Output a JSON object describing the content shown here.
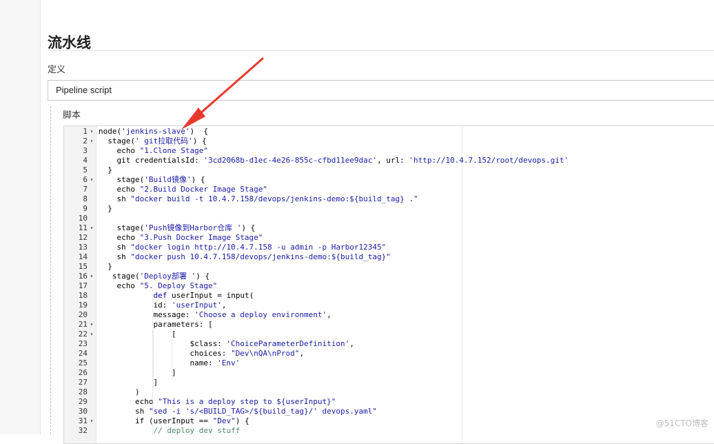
{
  "section": {
    "title": "流水线",
    "definition_label": "定义",
    "definition_value": "Pipeline script",
    "script_label": "脚本"
  },
  "editor": {
    "lines": [
      {
        "n": "1",
        "fold": true,
        "parts": [
          {
            "t": "node("
          },
          {
            "t": "'jenkins-slave'",
            "c": "str"
          },
          {
            "t": ")  {"
          }
        ]
      },
      {
        "n": "2",
        "fold": true,
        "parts": [
          {
            "t": "  stage("
          },
          {
            "t": "' git拉取代码'",
            "c": "str"
          },
          {
            "t": ") {"
          }
        ]
      },
      {
        "n": "3",
        "parts": [
          {
            "t": "    echo "
          },
          {
            "t": "\"1.Clone Stage\"",
            "c": "str"
          }
        ]
      },
      {
        "n": "4",
        "parts": [
          {
            "t": "    git credentialsId: "
          },
          {
            "t": "'3cd2068b-d1ec-4e26-855c-cfbd11ee9dac'",
            "c": "str"
          },
          {
            "t": ", url: "
          },
          {
            "t": "'http://10.4.7.152/root/devops.git'",
            "c": "str"
          }
        ]
      },
      {
        "n": "5",
        "parts": [
          {
            "t": "  }"
          }
        ]
      },
      {
        "n": "6",
        "fold": true,
        "parts": [
          {
            "t": "    stage("
          },
          {
            "t": "'Build镜像'",
            "c": "str"
          },
          {
            "t": ") {"
          }
        ]
      },
      {
        "n": "7",
        "parts": [
          {
            "t": "    echo "
          },
          {
            "t": "\"2.Build Docker Image Stage\"",
            "c": "str"
          }
        ]
      },
      {
        "n": "8",
        "parts": [
          {
            "t": "    sh "
          },
          {
            "t": "\"docker build -t 10.4.7.158/devops/jenkins-demo:${build_tag} .\"",
            "c": "str"
          }
        ]
      },
      {
        "n": "9",
        "parts": [
          {
            "t": "  }"
          }
        ]
      },
      {
        "n": "10",
        "parts": [
          {
            "t": ""
          }
        ]
      },
      {
        "n": "11",
        "fold": true,
        "parts": [
          {
            "t": "    stage("
          },
          {
            "t": "'Push镜像到Harbor仓库 '",
            "c": "str"
          },
          {
            "t": ") {"
          }
        ]
      },
      {
        "n": "12",
        "parts": [
          {
            "t": "    echo "
          },
          {
            "t": "\"3.Push Docker Image Stage\"",
            "c": "str"
          }
        ]
      },
      {
        "n": "13",
        "parts": [
          {
            "t": "    sh "
          },
          {
            "t": "\"docker login http://10.4.7.158 -u admin -p Harbor12345\"",
            "c": "str"
          }
        ]
      },
      {
        "n": "14",
        "parts": [
          {
            "t": "    sh "
          },
          {
            "t": "\"docker push 10.4.7.158/devops/jenkins-demo:${build_tag}\"",
            "c": "str"
          }
        ]
      },
      {
        "n": "15",
        "parts": [
          {
            "t": "  }"
          }
        ]
      },
      {
        "n": "16",
        "fold": true,
        "parts": [
          {
            "t": "   stage("
          },
          {
            "t": "'Deploy部署 '",
            "c": "str"
          },
          {
            "t": ") {"
          }
        ]
      },
      {
        "n": "17",
        "parts": [
          {
            "t": "    echo "
          },
          {
            "t": "\"5. Deploy Stage\"",
            "c": "str"
          }
        ]
      },
      {
        "n": "18",
        "parts": [
          {
            "t": "            "
          },
          {
            "t": "def",
            "c": "kw"
          },
          {
            "t": " userInput = input("
          }
        ]
      },
      {
        "n": "19",
        "parts": [
          {
            "t": "            id: "
          },
          {
            "t": "'userInput'",
            "c": "str"
          },
          {
            "t": ","
          }
        ]
      },
      {
        "n": "20",
        "parts": [
          {
            "t": "            message: "
          },
          {
            "t": "'Choose a deploy environment'",
            "c": "str"
          },
          {
            "t": ","
          }
        ]
      },
      {
        "n": "21",
        "fold": true,
        "parts": [
          {
            "t": "            parameters: ["
          }
        ]
      },
      {
        "n": "22",
        "fold": true,
        "parts": [
          {
            "t": "                ["
          }
        ]
      },
      {
        "n": "23",
        "parts": [
          {
            "t": "                    $class: "
          },
          {
            "t": "'ChoiceParameterDefinition'",
            "c": "str"
          },
          {
            "t": ","
          }
        ]
      },
      {
        "n": "24",
        "parts": [
          {
            "t": "                    choices: "
          },
          {
            "t": "\"Dev\\nQA\\nProd\"",
            "c": "str"
          },
          {
            "t": ","
          }
        ]
      },
      {
        "n": "25",
        "parts": [
          {
            "t": "                    name: "
          },
          {
            "t": "'Env'",
            "c": "str"
          }
        ]
      },
      {
        "n": "26",
        "parts": [
          {
            "t": "                ]"
          }
        ]
      },
      {
        "n": "27",
        "parts": [
          {
            "t": "            ]"
          }
        ]
      },
      {
        "n": "28",
        "parts": [
          {
            "t": "        )"
          }
        ]
      },
      {
        "n": "29",
        "parts": [
          {
            "t": "        echo "
          },
          {
            "t": "\"This is a deploy step to ${userInput}\"",
            "c": "str"
          }
        ]
      },
      {
        "n": "30",
        "parts": [
          {
            "t": "        sh "
          },
          {
            "t": "\"sed -i 's/<BUILD_TAG>/${build_tag}/' devops.yaml\"",
            "c": "str"
          }
        ]
      },
      {
        "n": "31",
        "fold": true,
        "parts": [
          {
            "t": "        if (userInput == "
          },
          {
            "t": "\"Dev\"",
            "c": "str"
          },
          {
            "t": ") {"
          }
        ]
      },
      {
        "n": "32",
        "parts": [
          {
            "t": "            "
          },
          {
            "t": "// deploy dev stuff",
            "c": "cm"
          }
        ]
      }
    ]
  },
  "watermark": "@51CTO博客",
  "colors": {
    "arrow": "#e8382c",
    "string": "#1a1aa6",
    "keyword": "#0000aa",
    "comment": "#4c886b"
  }
}
